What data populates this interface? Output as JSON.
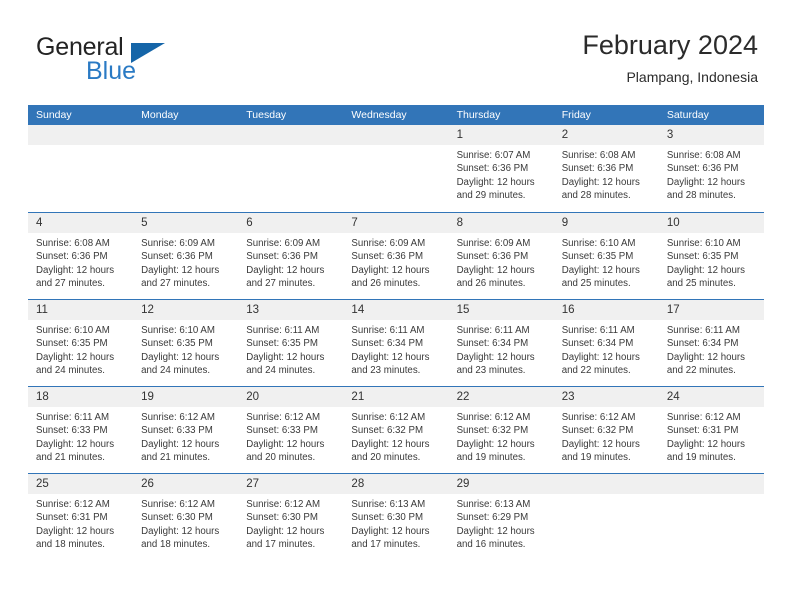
{
  "brand": {
    "name_primary": "General",
    "name_secondary": "Blue",
    "triangle_color": "#1565a8",
    "blue_color": "#2a7ac4"
  },
  "header": {
    "title": "February 2024",
    "subtitle": "Plampang, Indonesia"
  },
  "theme": {
    "header_blue": "#3275b8",
    "day_band_gray": "#f0f0f0",
    "text_color": "#3a3a3a"
  },
  "weekdays": [
    "Sunday",
    "Monday",
    "Tuesday",
    "Wednesday",
    "Thursday",
    "Friday",
    "Saturday"
  ],
  "weeks": [
    [
      {
        "date": "",
        "sunrise": "",
        "sunset": "",
        "daylight_1": "",
        "daylight_2": ""
      },
      {
        "date": "",
        "sunrise": "",
        "sunset": "",
        "daylight_1": "",
        "daylight_2": ""
      },
      {
        "date": "",
        "sunrise": "",
        "sunset": "",
        "daylight_1": "",
        "daylight_2": ""
      },
      {
        "date": "",
        "sunrise": "",
        "sunset": "",
        "daylight_1": "",
        "daylight_2": ""
      },
      {
        "date": "1",
        "sunrise": "Sunrise: 6:07 AM",
        "sunset": "Sunset: 6:36 PM",
        "daylight_1": "Daylight: 12 hours",
        "daylight_2": "and 29 minutes."
      },
      {
        "date": "2",
        "sunrise": "Sunrise: 6:08 AM",
        "sunset": "Sunset: 6:36 PM",
        "daylight_1": "Daylight: 12 hours",
        "daylight_2": "and 28 minutes."
      },
      {
        "date": "3",
        "sunrise": "Sunrise: 6:08 AM",
        "sunset": "Sunset: 6:36 PM",
        "daylight_1": "Daylight: 12 hours",
        "daylight_2": "and 28 minutes."
      }
    ],
    [
      {
        "date": "4",
        "sunrise": "Sunrise: 6:08 AM",
        "sunset": "Sunset: 6:36 PM",
        "daylight_1": "Daylight: 12 hours",
        "daylight_2": "and 27 minutes."
      },
      {
        "date": "5",
        "sunrise": "Sunrise: 6:09 AM",
        "sunset": "Sunset: 6:36 PM",
        "daylight_1": "Daylight: 12 hours",
        "daylight_2": "and 27 minutes."
      },
      {
        "date": "6",
        "sunrise": "Sunrise: 6:09 AM",
        "sunset": "Sunset: 6:36 PM",
        "daylight_1": "Daylight: 12 hours",
        "daylight_2": "and 27 minutes."
      },
      {
        "date": "7",
        "sunrise": "Sunrise: 6:09 AM",
        "sunset": "Sunset: 6:36 PM",
        "daylight_1": "Daylight: 12 hours",
        "daylight_2": "and 26 minutes."
      },
      {
        "date": "8",
        "sunrise": "Sunrise: 6:09 AM",
        "sunset": "Sunset: 6:36 PM",
        "daylight_1": "Daylight: 12 hours",
        "daylight_2": "and 26 minutes."
      },
      {
        "date": "9",
        "sunrise": "Sunrise: 6:10 AM",
        "sunset": "Sunset: 6:35 PM",
        "daylight_1": "Daylight: 12 hours",
        "daylight_2": "and 25 minutes."
      },
      {
        "date": "10",
        "sunrise": "Sunrise: 6:10 AM",
        "sunset": "Sunset: 6:35 PM",
        "daylight_1": "Daylight: 12 hours",
        "daylight_2": "and 25 minutes."
      }
    ],
    [
      {
        "date": "11",
        "sunrise": "Sunrise: 6:10 AM",
        "sunset": "Sunset: 6:35 PM",
        "daylight_1": "Daylight: 12 hours",
        "daylight_2": "and 24 minutes."
      },
      {
        "date": "12",
        "sunrise": "Sunrise: 6:10 AM",
        "sunset": "Sunset: 6:35 PM",
        "daylight_1": "Daylight: 12 hours",
        "daylight_2": "and 24 minutes."
      },
      {
        "date": "13",
        "sunrise": "Sunrise: 6:11 AM",
        "sunset": "Sunset: 6:35 PM",
        "daylight_1": "Daylight: 12 hours",
        "daylight_2": "and 24 minutes."
      },
      {
        "date": "14",
        "sunrise": "Sunrise: 6:11 AM",
        "sunset": "Sunset: 6:34 PM",
        "daylight_1": "Daylight: 12 hours",
        "daylight_2": "and 23 minutes."
      },
      {
        "date": "15",
        "sunrise": "Sunrise: 6:11 AM",
        "sunset": "Sunset: 6:34 PM",
        "daylight_1": "Daylight: 12 hours",
        "daylight_2": "and 23 minutes."
      },
      {
        "date": "16",
        "sunrise": "Sunrise: 6:11 AM",
        "sunset": "Sunset: 6:34 PM",
        "daylight_1": "Daylight: 12 hours",
        "daylight_2": "and 22 minutes."
      },
      {
        "date": "17",
        "sunrise": "Sunrise: 6:11 AM",
        "sunset": "Sunset: 6:34 PM",
        "daylight_1": "Daylight: 12 hours",
        "daylight_2": "and 22 minutes."
      }
    ],
    [
      {
        "date": "18",
        "sunrise": "Sunrise: 6:11 AM",
        "sunset": "Sunset: 6:33 PM",
        "daylight_1": "Daylight: 12 hours",
        "daylight_2": "and 21 minutes."
      },
      {
        "date": "19",
        "sunrise": "Sunrise: 6:12 AM",
        "sunset": "Sunset: 6:33 PM",
        "daylight_1": "Daylight: 12 hours",
        "daylight_2": "and 21 minutes."
      },
      {
        "date": "20",
        "sunrise": "Sunrise: 6:12 AM",
        "sunset": "Sunset: 6:33 PM",
        "daylight_1": "Daylight: 12 hours",
        "daylight_2": "and 20 minutes."
      },
      {
        "date": "21",
        "sunrise": "Sunrise: 6:12 AM",
        "sunset": "Sunset: 6:32 PM",
        "daylight_1": "Daylight: 12 hours",
        "daylight_2": "and 20 minutes."
      },
      {
        "date": "22",
        "sunrise": "Sunrise: 6:12 AM",
        "sunset": "Sunset: 6:32 PM",
        "daylight_1": "Daylight: 12 hours",
        "daylight_2": "and 19 minutes."
      },
      {
        "date": "23",
        "sunrise": "Sunrise: 6:12 AM",
        "sunset": "Sunset: 6:32 PM",
        "daylight_1": "Daylight: 12 hours",
        "daylight_2": "and 19 minutes."
      },
      {
        "date": "24",
        "sunrise": "Sunrise: 6:12 AM",
        "sunset": "Sunset: 6:31 PM",
        "daylight_1": "Daylight: 12 hours",
        "daylight_2": "and 19 minutes."
      }
    ],
    [
      {
        "date": "25",
        "sunrise": "Sunrise: 6:12 AM",
        "sunset": "Sunset: 6:31 PM",
        "daylight_1": "Daylight: 12 hours",
        "daylight_2": "and 18 minutes."
      },
      {
        "date": "26",
        "sunrise": "Sunrise: 6:12 AM",
        "sunset": "Sunset: 6:30 PM",
        "daylight_1": "Daylight: 12 hours",
        "daylight_2": "and 18 minutes."
      },
      {
        "date": "27",
        "sunrise": "Sunrise: 6:12 AM",
        "sunset": "Sunset: 6:30 PM",
        "daylight_1": "Daylight: 12 hours",
        "daylight_2": "and 17 minutes."
      },
      {
        "date": "28",
        "sunrise": "Sunrise: 6:13 AM",
        "sunset": "Sunset: 6:30 PM",
        "daylight_1": "Daylight: 12 hours",
        "daylight_2": "and 17 minutes."
      },
      {
        "date": "29",
        "sunrise": "Sunrise: 6:13 AM",
        "sunset": "Sunset: 6:29 PM",
        "daylight_1": "Daylight: 12 hours",
        "daylight_2": "and 16 minutes."
      },
      {
        "date": "",
        "sunrise": "",
        "sunset": "",
        "daylight_1": "",
        "daylight_2": ""
      },
      {
        "date": "",
        "sunrise": "",
        "sunset": "",
        "daylight_1": "",
        "daylight_2": ""
      }
    ]
  ]
}
